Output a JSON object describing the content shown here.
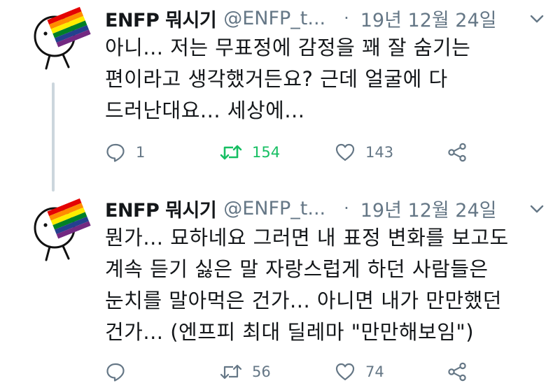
{
  "tweets": [
    {
      "name": "ENFP 뭐시기",
      "handle": "@ENFP_t...",
      "separator": "·",
      "time": "19년 12월 24일",
      "lines": [
        "아니... 저는 무표정에 감정을 꽤 잘 숨기는",
        "편이라고 생각했거든요? 근데 얼굴에 다",
        "드러난대요... 세상에..."
      ],
      "replies": "1",
      "retweets": "154",
      "likes": "143",
      "retweeted": true
    },
    {
      "name": "ENFP 뭐시기",
      "handle": "@ENFP_t...",
      "separator": "·",
      "time": "19년 12월 24일",
      "lines": [
        "뭔가... 묘하네요 그러면 내 표정 변화를 보고도",
        "계속 듣기 싫은 말 자랑스럽게 하던 사람들은",
        "눈치를 말아먹은 건가... 아니면 내가 만만했던",
        "건가... (엔프피 최대 딜레마 \"만만해보임\")"
      ],
      "replies": "",
      "retweets": "56",
      "likes": "74",
      "retweeted": false
    }
  ],
  "colors": {
    "text": "#14171a",
    "secondary": "#657786",
    "retweet_active": "#17bf63",
    "thread_line": "#ccd6dd"
  },
  "icons": {
    "avatar": "rainbow-flag-head-avatar",
    "caret": "chevron-down-icon",
    "reply": "reply-icon",
    "retweet": "retweet-icon",
    "like": "heart-icon",
    "share": "share-icon"
  }
}
